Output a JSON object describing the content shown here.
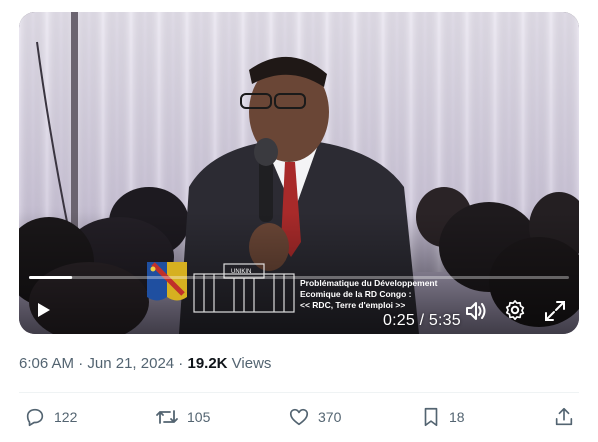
{
  "video": {
    "lower_third": {
      "line1": "Problématique du Développement",
      "line2": "Ecomique de la RD Congo :",
      "line3": "<< RDC, Terre d'emploi >>",
      "building_label": "UNIKIN"
    },
    "progress": 0.08,
    "time_display": "0:25 / 5:35",
    "icons": [
      "play-icon",
      "volume-icon",
      "settings-icon",
      "fullscreen-icon"
    ]
  },
  "meta": {
    "time": "6:06 AM",
    "separator1": " · ",
    "date": "Jun 21, 2024",
    "separator2": " · ",
    "views_count": "19.2K",
    "views_label": " Views"
  },
  "actions": {
    "reply_count": "122",
    "repost_count": "105",
    "like_count": "370",
    "bookmark_count": "18"
  },
  "colors": {
    "icon_gray": "#536471",
    "text_dark": "#0f1419",
    "divider": "#eff3f4"
  }
}
